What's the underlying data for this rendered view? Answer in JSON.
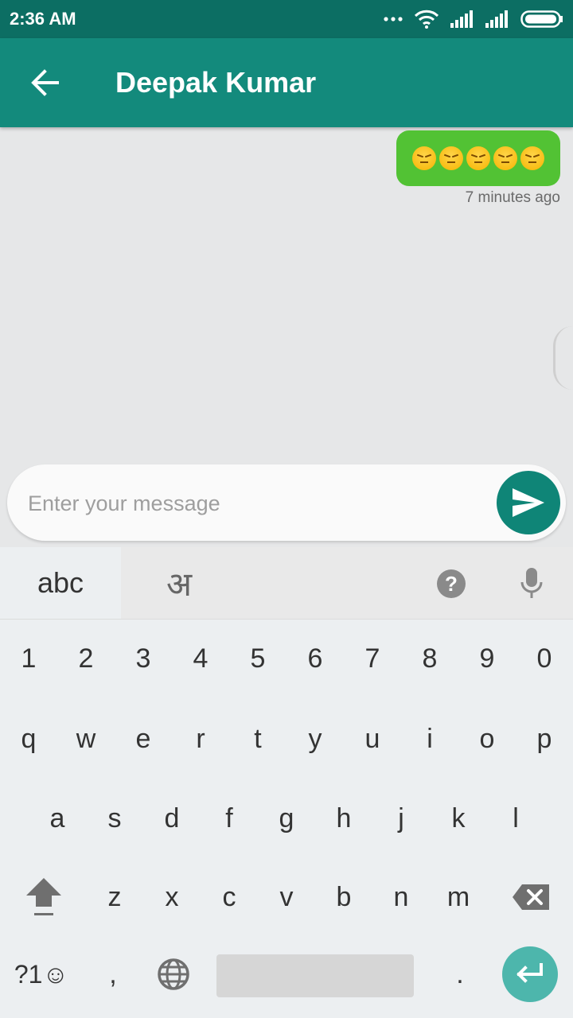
{
  "status_bar": {
    "time": "2:36 AM",
    "icons": [
      "more-dots-icon",
      "wifi-icon",
      "signal-icon",
      "signal-icon",
      "battery-icon"
    ]
  },
  "app_bar": {
    "back_icon": "arrow-back-icon",
    "title": "Deepak Kumar"
  },
  "messages": [
    {
      "direction": "outgoing",
      "content": "😣😣😣😣😣",
      "timestamp": "7 minutes ago"
    }
  ],
  "composer": {
    "value": "",
    "placeholder": "Enter your message",
    "send_icon": "send-icon"
  },
  "keyboard": {
    "tabs": {
      "abc": "abc",
      "hindi": "अ"
    },
    "help_label": "?",
    "mic_icon": "mic-icon",
    "number_row": [
      "1",
      "2",
      "3",
      "4",
      "5",
      "6",
      "7",
      "8",
      "9",
      "0"
    ],
    "row1": [
      "q",
      "w",
      "e",
      "r",
      "t",
      "y",
      "u",
      "i",
      "o",
      "p"
    ],
    "row2": [
      "a",
      "s",
      "d",
      "f",
      "g",
      "h",
      "j",
      "k",
      "l"
    ],
    "row3": [
      "z",
      "x",
      "c",
      "v",
      "b",
      "n",
      "m"
    ],
    "symbols_label": "?1☺",
    "comma": ",",
    "period": ".",
    "shift_icon": "shift-icon",
    "backspace_icon": "backspace-icon",
    "globe_icon": "globe-icon",
    "enter_icon": "enter-icon"
  },
  "colors": {
    "status_bar": "#0c6e63",
    "app_bar": "#138a7c",
    "bubble": "#52c234",
    "send_button": "#0f8577",
    "enter_button": "#4db6ac"
  }
}
